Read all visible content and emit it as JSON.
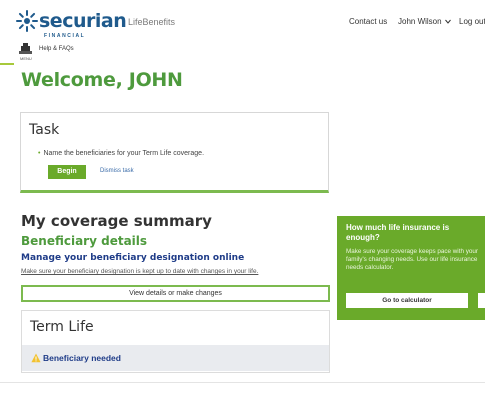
{
  "header": {
    "logo_name": "securian",
    "logo_sub": "FINANCIAL",
    "app_name": "LifeBenefits",
    "nav": {
      "contact": "Contact us",
      "user": "John Wilson",
      "logout": "Log out"
    },
    "help_icon_label": "MENU",
    "help_link": "Help & FAQs"
  },
  "welcome": "Welcome, JOHN",
  "task": {
    "title": "Task",
    "item": "Name the beneficiaries for your Term Life coverage.",
    "begin_label": "Begin",
    "dismiss_label": "Dismiss task"
  },
  "coverage": {
    "title": "My coverage summary",
    "beneficiary_title": "Beneficiary details",
    "manage_title": "Manage your beneficiary designation online",
    "manage_text": "Make sure your beneficiary designation is kept up to date with changes in your life.",
    "view_button": "View details or make changes"
  },
  "term_life": {
    "title": "Term Life",
    "status": "Beneficiary needed"
  },
  "calculator": {
    "title": "How much life insurance is enough?",
    "text": "Make sure your coverage keeps pace with your family's changing needs. Use our life insurance needs calculator.",
    "button": "Go to calculator"
  },
  "colors": {
    "green": "#6aaa2a",
    "heading_green": "#4e9a3d",
    "navy": "#1f3c88",
    "brand_blue": "#1f5a8c"
  }
}
